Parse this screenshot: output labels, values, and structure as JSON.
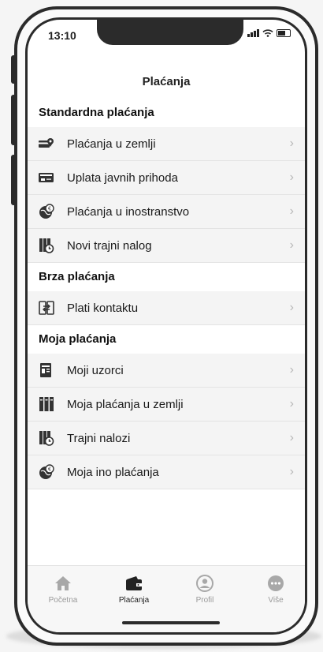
{
  "status": {
    "time": "13:10"
  },
  "header": {
    "title": "Plaćanja"
  },
  "sections": [
    {
      "title": "Standardna plaćanja",
      "items": [
        {
          "label": "Plaćanja u zemlji",
          "icon": "card-pin-icon"
        },
        {
          "label": "Uplata javnih prihoda",
          "icon": "card-chip-icon"
        },
        {
          "label": "Plaćanja u inostranstvo",
          "icon": "globe-euro-icon"
        },
        {
          "label": "Novi trajni nalog",
          "icon": "binders-clock-icon"
        }
      ]
    },
    {
      "title": "Brza plaćanja",
      "items": [
        {
          "label": "Plati kontaktu",
          "icon": "contact-transfer-icon"
        }
      ]
    },
    {
      "title": "Moja plaćanja",
      "items": [
        {
          "label": "Moji uzorci",
          "icon": "document-template-icon"
        },
        {
          "label": "Moja plaćanja u zemlji",
          "icon": "binders-icon"
        },
        {
          "label": "Trajni nalozi",
          "icon": "binders-clock-icon"
        },
        {
          "label": "Moja ino plaćanja",
          "icon": "globe-euro-icon"
        }
      ]
    }
  ],
  "tabs": [
    {
      "label": "Početna",
      "icon": "home-icon",
      "active": false
    },
    {
      "label": "Plaćanja",
      "icon": "wallet-icon",
      "active": true
    },
    {
      "label": "Profil",
      "icon": "profile-icon",
      "active": false
    },
    {
      "label": "Više",
      "icon": "more-icon",
      "active": false
    }
  ],
  "colors": {
    "text": "#1a1a1a",
    "row_bg": "#f4f4f4",
    "chevron": "#b8b8b8",
    "tab_inactive": "#9a9a9a"
  }
}
